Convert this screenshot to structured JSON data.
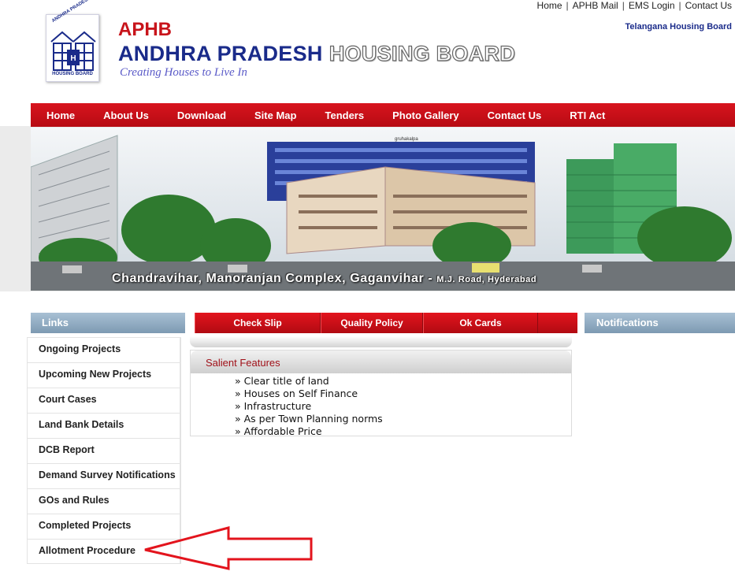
{
  "top_links": [
    "Home",
    "APHB Mail",
    "EMS Login",
    "Contact Us"
  ],
  "top_separator": "|",
  "telangana_link": "Telangana Housing Board",
  "logo": {
    "top_text": "ANDHRA PRADESH",
    "bottom_text": "HOUSING BOARD"
  },
  "header": {
    "short_title": "APHB",
    "title_part1": "ANDHRA PRADESH",
    "title_part2": "HOUSING BOARD",
    "tagline": "Creating Houses to Live In"
  },
  "nav": [
    "Home",
    "About Us",
    "Download",
    "Site Map",
    "Tenders",
    "Photo Gallery",
    "Contact Us",
    "RTI Act"
  ],
  "banner": {
    "caption_main": "Chandravihar, Manoranjan Complex, Gaganvihar - ",
    "caption_small": "M.J. Road, Hyderabad",
    "sign_text": "gruhakalpa"
  },
  "links": {
    "heading": "Links",
    "items": [
      "Ongoing Projects",
      "Upcoming New Projects",
      "Court Cases",
      "Land Bank Details",
      "DCB Report",
      "Demand Survey Notifications",
      "GOs and Rules",
      "Completed Projects",
      "Allotment Procedure"
    ]
  },
  "middle_tabs": [
    "Check Slip",
    "Quality Policy",
    "Ok Cards"
  ],
  "salient": {
    "heading": "Salient Features",
    "items": [
      "» Clear title of land",
      "» Houses on Self Finance",
      "» Infrastructure",
      "» As per Town Planning norms",
      "» Affordable Price"
    ]
  },
  "notifications_heading": "Notifications",
  "colors": {
    "nav_red": "#c8141b",
    "panel_blue": "#8fa9bf",
    "title_blue": "#1a2b8a",
    "arrow_red": "#e3141d"
  }
}
